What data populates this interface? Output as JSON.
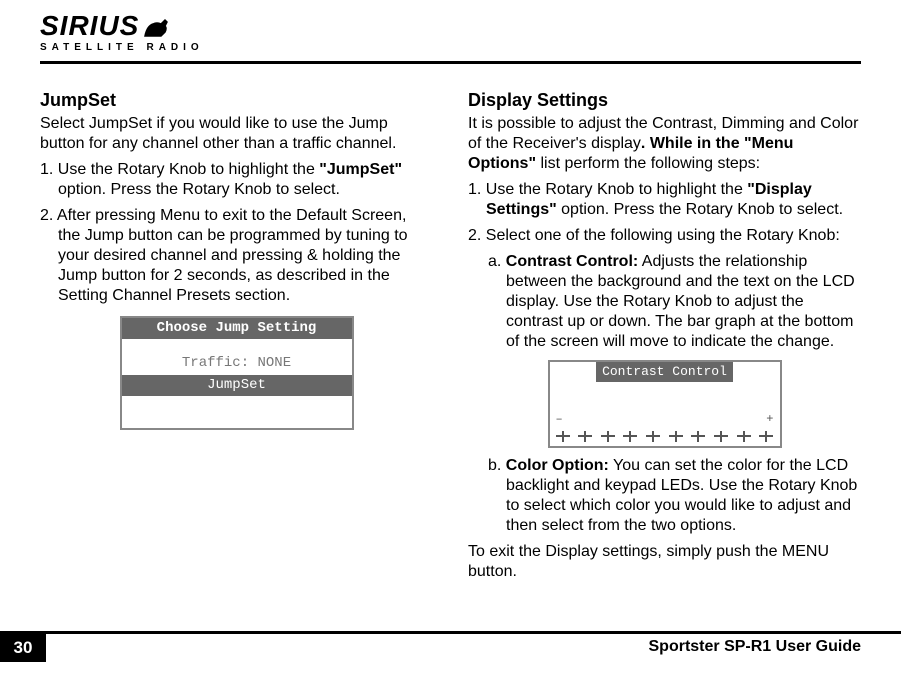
{
  "header": {
    "brand_main": "SIRIUS",
    "brand_sub": "SATELLITE RADIO"
  },
  "left": {
    "h": "JumpSet",
    "intro": "Select JumpSet if you would like to use the Jump button for any channel other than a traffic channel.",
    "step1_prefix": "1. Use the Rotary Knob to highlight the ",
    "step1_bold": "\"JumpSet\"",
    "step1_suffix": " option.  Press the Rotary Knob to select.",
    "step2": "2. After pressing Menu to exit to the Default Screen, the Jump button can be programmed by tuning to your desired channel and pressing & holding the Jump button for 2 seconds, as described in the Setting Channel Presets section.",
    "lcd": {
      "header": "Choose Jump Setting",
      "line1": "Traffic: NONE",
      "selected": "JumpSet"
    }
  },
  "right": {
    "h": "Display Settings",
    "intro_prefix": "It is possible to adjust the Contrast, Dimming and Color of the Receiver's display",
    "intro_bold1": ". While in the ",
    "intro_bold2": "\"Menu Options\"",
    "intro_suffix": " list perform the following steps:",
    "step1_prefix": "1. Use the Rotary Knob to highlight the ",
    "step1_bold": "\"Display Settings\"",
    "step1_suffix": " option. Press the Rotary Knob to select.",
    "step2": "2. Select one of the following using the Rotary Knob:",
    "sub_a_label": "a. ",
    "sub_a_bold": "Contrast Control:",
    "sub_a_text": " Adjusts the relationship between the background and the text on the LCD display. Use the Rotary Knob to adjust the contrast up or down. The bar graph at the bottom of the screen will move to indicate the change.",
    "lcd2": {
      "header": "Contrast Control",
      "minus": "–",
      "plus": "+"
    },
    "sub_b_label": "b. ",
    "sub_b_bold": "Color Option:",
    "sub_b_text": " You can set the color for the LCD backlight and keypad LEDs.  Use the Rotary Knob to select which color you would like to adjust and then select from the two options.",
    "exit": "To exit the Display settings, simply push the MENU button."
  },
  "footer": {
    "page": "30",
    "guide": "Sportster SP-R1 User Guide"
  }
}
